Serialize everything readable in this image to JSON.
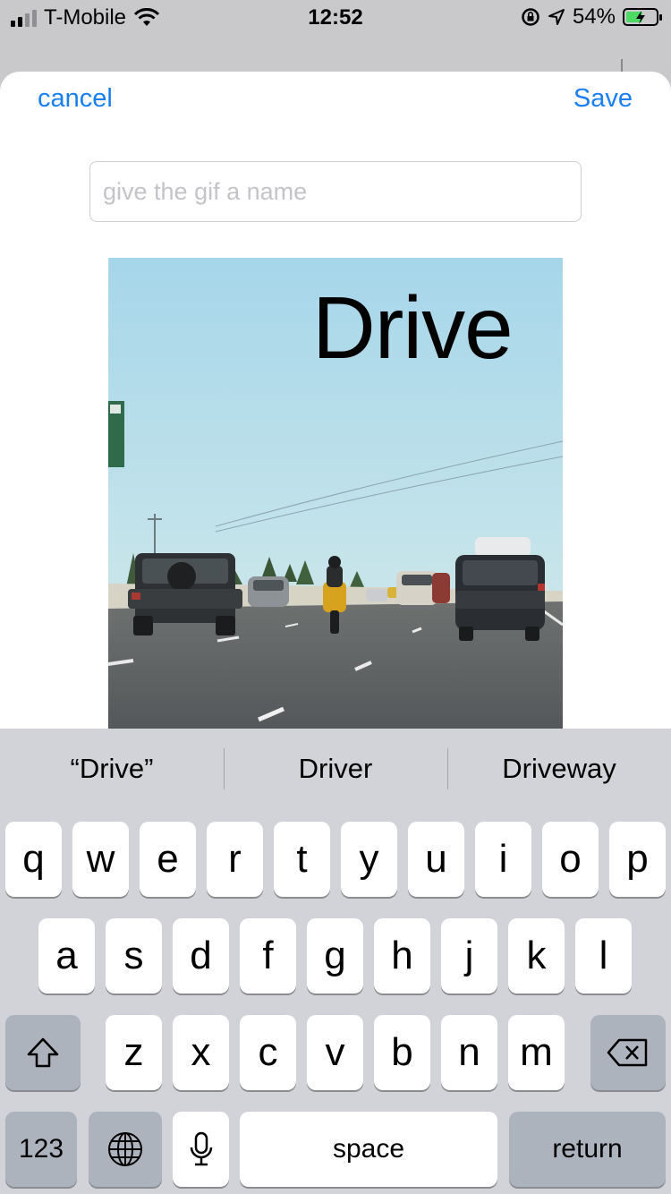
{
  "status_bar": {
    "carrier": "T-Mobile",
    "time": "12:52",
    "battery_percent": "54%",
    "icons": [
      "signal-icon",
      "wifi-icon",
      "rotation-lock-icon",
      "location-arrow-icon",
      "battery-icon"
    ]
  },
  "sheet": {
    "cancel_label": "cancel",
    "save_label": "Save",
    "name_placeholder": "give the gif a name",
    "name_value": ""
  },
  "gif": {
    "overlay_text": "Drive"
  },
  "keyboard": {
    "suggestions": [
      "“Drive”",
      "Driver",
      "Driveway"
    ],
    "row1": [
      "q",
      "w",
      "e",
      "r",
      "t",
      "y",
      "u",
      "i",
      "o",
      "p"
    ],
    "row2": [
      "a",
      "s",
      "d",
      "f",
      "g",
      "h",
      "j",
      "k",
      "l"
    ],
    "row3": [
      "z",
      "x",
      "c",
      "v",
      "b",
      "n",
      "m"
    ],
    "numbers_label": "123",
    "space_label": "space",
    "return_label": "return"
  },
  "colors": {
    "accent": "#1a7ff3",
    "keyboard_bg": "#d1d3d9",
    "battery_fill": "#4cd964"
  }
}
